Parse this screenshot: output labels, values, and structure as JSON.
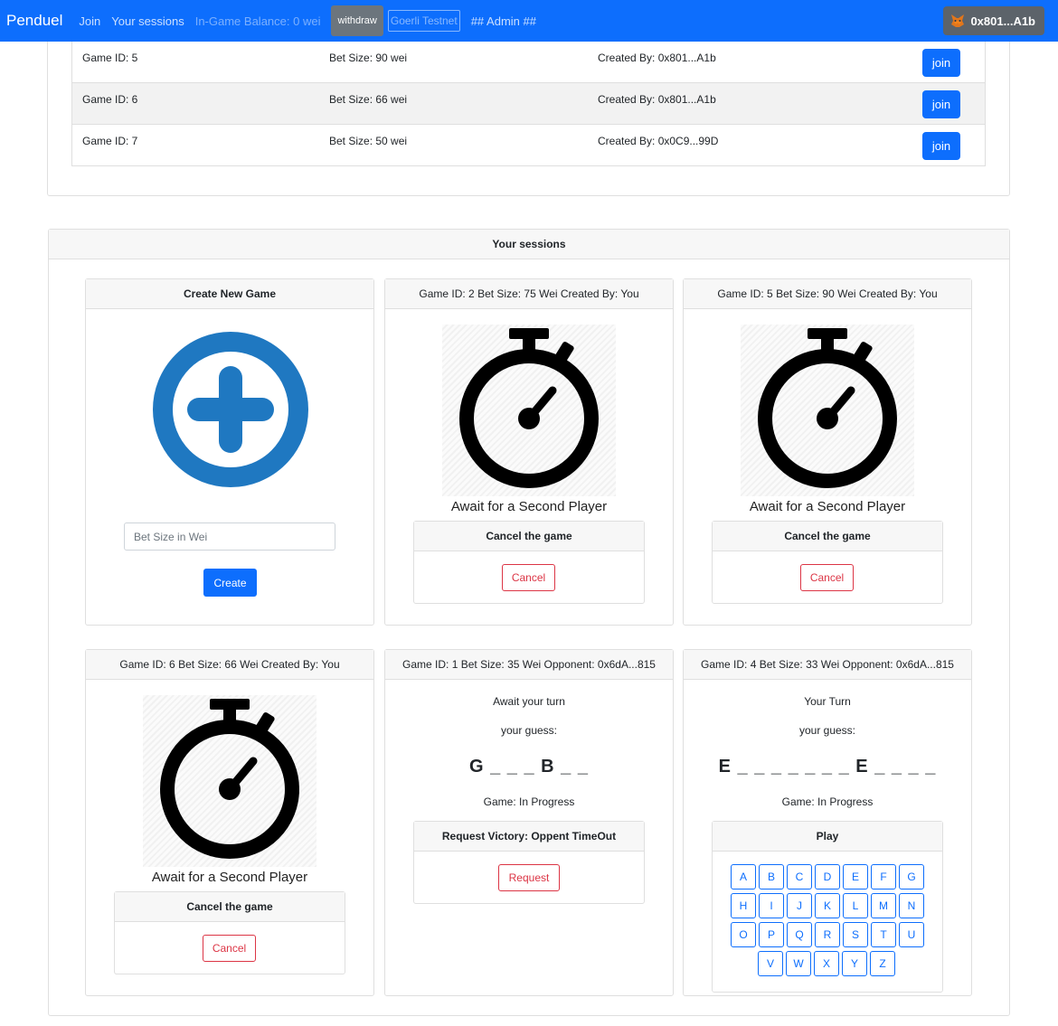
{
  "navbar": {
    "brand": "Penduel",
    "links": [
      "Join",
      "Your sessions"
    ],
    "balance": "In-Game Balance: 0 wei",
    "withdraw_label": "withdraw",
    "network_label": "Goerli Testnet",
    "admin_label": "## Admin ##",
    "wallet_address": "0x801...A1b",
    "colors": {
      "primary": "#0d6efd",
      "secondary": "#6c757d"
    }
  },
  "join_list": {
    "rows": [
      {
        "game_id": "Game ID: 5",
        "bet": "Bet Size: 90 wei",
        "creator": "Created By: 0x801...A1b",
        "action": "join"
      },
      {
        "game_id": "Game ID: 6",
        "bet": "Bet Size: 66 wei",
        "creator": "Created By: 0x801...A1b",
        "action": "join"
      },
      {
        "game_id": "Game ID: 7",
        "bet": "Bet Size: 50 wei",
        "creator": "Created By: 0x0C9...99D",
        "action": "join"
      }
    ]
  },
  "sessions": {
    "title": "Your sessions",
    "create": {
      "title": "Create New Game",
      "icon": "plus-circle-icon",
      "input_placeholder": "Bet Size in Wei",
      "button_label": "Create"
    },
    "waiting": [
      {
        "header": "Game ID: 2 Bet Size: 75 Wei Created By: You",
        "status": "Await for a Second Player",
        "cancel_title": "Cancel the game",
        "cancel_label": "Cancel",
        "icon": "stopwatch-icon"
      },
      {
        "header": "Game ID: 5 Bet Size: 90 Wei Created By: You",
        "status": "Await for a Second Player",
        "cancel_title": "Cancel the game",
        "cancel_label": "Cancel",
        "icon": "stopwatch-icon"
      },
      {
        "header": "Game ID: 6 Bet Size: 66 Wei Created By: You",
        "status": "Await for a Second Player",
        "cancel_title": "Cancel the game",
        "cancel_label": "Cancel",
        "icon": "stopwatch-icon"
      }
    ],
    "in_progress": [
      {
        "header": "Game ID: 1 Bet Size: 35 Wei Opponent: 0x6dA...815",
        "turn": "Await your turn",
        "guess_label": "your guess:",
        "word": "G _ _ _ B _ _",
        "status": "Game: In Progress",
        "action_title": "Request Victory: Oppent TimeOut",
        "action_label": "Request"
      },
      {
        "header": "Game ID: 4 Bet Size: 33 Wei Opponent: 0x6dA...815",
        "turn": "Your Turn",
        "guess_label": "your guess:",
        "word": "E _ _ _ _ _ _ _ E _ _ _ _",
        "status": "Game: In Progress",
        "action_title": "Play"
      }
    ],
    "letters": [
      "A",
      "B",
      "C",
      "D",
      "E",
      "F",
      "G",
      "H",
      "I",
      "J",
      "K",
      "L",
      "M",
      "N",
      "O",
      "P",
      "Q",
      "R",
      "S",
      "T",
      "U",
      "V",
      "W",
      "X",
      "Y",
      "Z"
    ]
  }
}
